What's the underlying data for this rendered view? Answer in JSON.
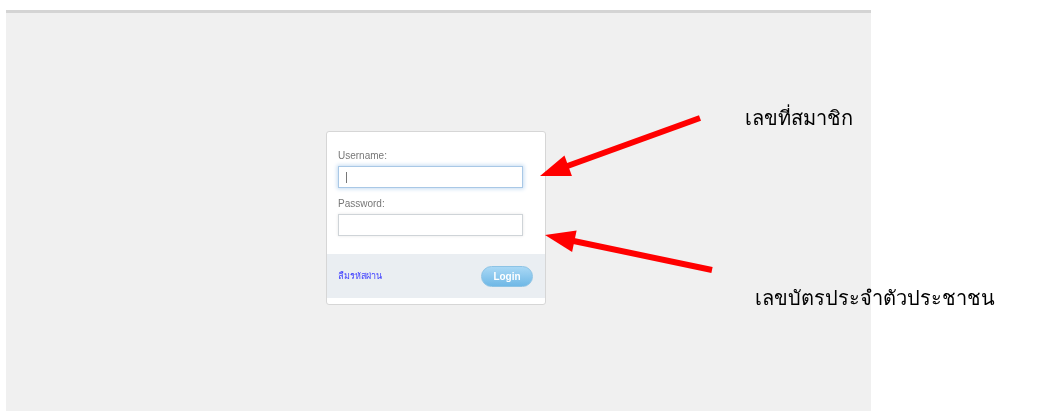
{
  "login_form": {
    "fields": [
      {
        "label": "Username:",
        "focused": true
      },
      {
        "label": "Password:",
        "focused": false
      }
    ],
    "forgot_link": "ลืมรหัสผ่าน",
    "button": "Login"
  },
  "annotations": [
    {
      "text": "เลขที่สมาชิก"
    },
    {
      "text": "เลขบัตรประจำตัวประชาชน"
    }
  ]
}
